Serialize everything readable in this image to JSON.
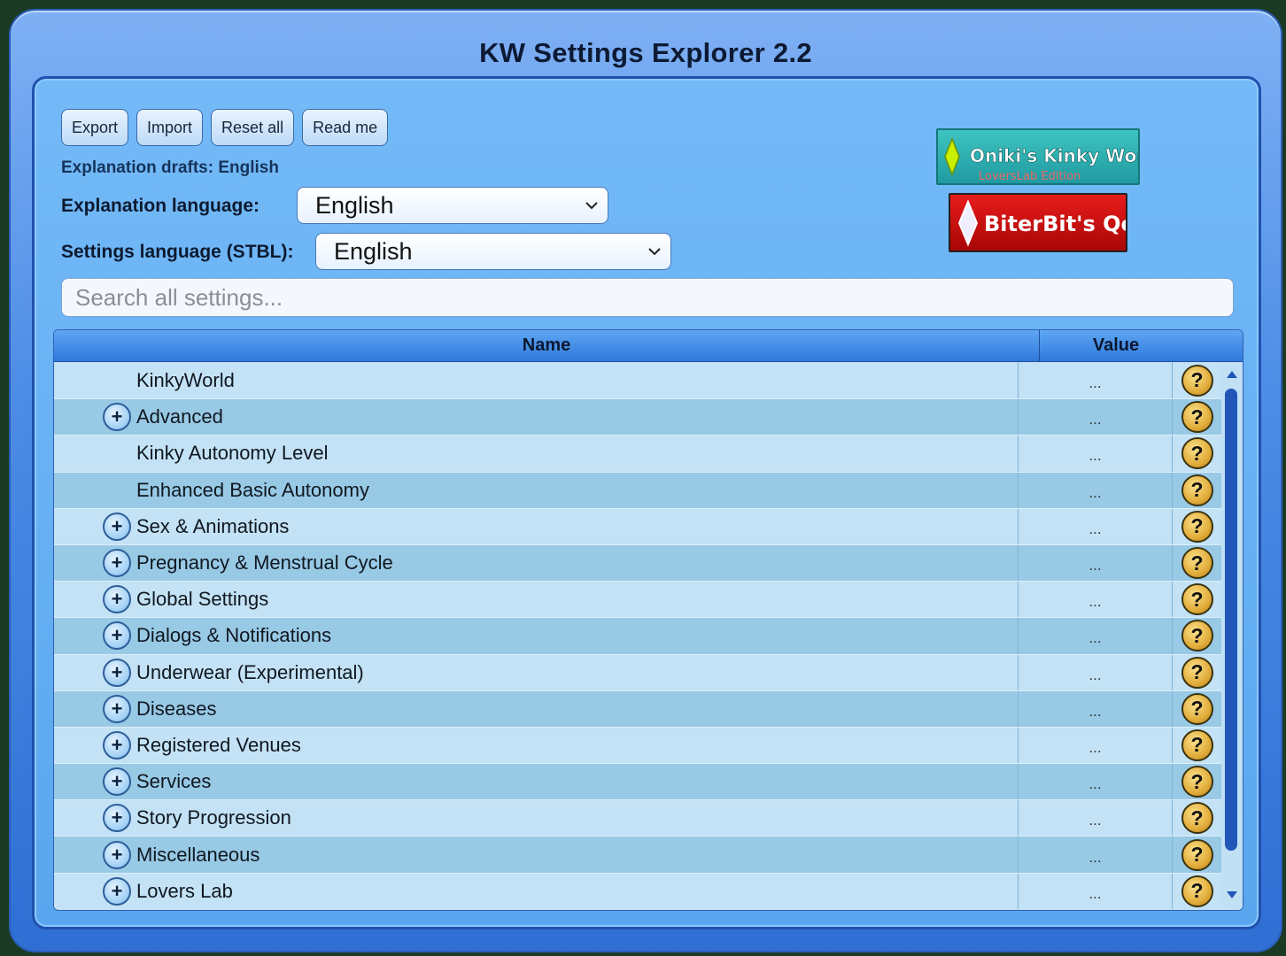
{
  "window": {
    "title": "KW Settings Explorer 2.2"
  },
  "toolbar": {
    "export_label": "Export",
    "import_label": "Import",
    "reset_label": "Reset all",
    "readme_label": "Read me"
  },
  "drafts_text": "Explanation drafts: English",
  "explanation_language": {
    "label": "Explanation language:",
    "value": "English"
  },
  "settings_language": {
    "label": "Settings language (STBL):",
    "value": "English"
  },
  "search": {
    "placeholder": "Search all settings..."
  },
  "logos": {
    "oniki": {
      "line1": "Oniki's Kinky World",
      "line2": "LoversLab Edition"
    },
    "biterbit": {
      "text": "BiterBit's QoL"
    }
  },
  "table": {
    "headers": {
      "name": "Name",
      "value": "Value"
    },
    "rows": [
      {
        "name": "KinkyWorld",
        "value": "...",
        "expandable": false
      },
      {
        "name": "Advanced",
        "value": "...",
        "expandable": true
      },
      {
        "name": "Kinky Autonomy Level",
        "value": "...",
        "expandable": false
      },
      {
        "name": "Enhanced Basic Autonomy",
        "value": "...",
        "expandable": false
      },
      {
        "name": "Sex & Animations",
        "value": "...",
        "expandable": true
      },
      {
        "name": "Pregnancy & Menstrual Cycle",
        "value": "...",
        "expandable": true
      },
      {
        "name": "Global Settings",
        "value": "...",
        "expandable": true
      },
      {
        "name": "Dialogs & Notifications",
        "value": "...",
        "expandable": true
      },
      {
        "name": "Underwear (Experimental)",
        "value": "...",
        "expandable": true
      },
      {
        "name": "Diseases",
        "value": "...",
        "expandable": true
      },
      {
        "name": "Registered Venues",
        "value": "...",
        "expandable": true
      },
      {
        "name": "Services",
        "value": "...",
        "expandable": true
      },
      {
        "name": "Story Progression",
        "value": "...",
        "expandable": true
      },
      {
        "name": "Miscellaneous",
        "value": "...",
        "expandable": true
      },
      {
        "name": "Lovers Lab",
        "value": "...",
        "expandable": true
      }
    ],
    "help_symbol": "?",
    "expand_symbol": "+"
  },
  "colors": {
    "window_blue": "#4d8de6",
    "header_blue": "#2f79dd",
    "help_gold": "#e2ad3b",
    "logo_teal": "#1f9aa1",
    "logo_red": "#d81515"
  }
}
